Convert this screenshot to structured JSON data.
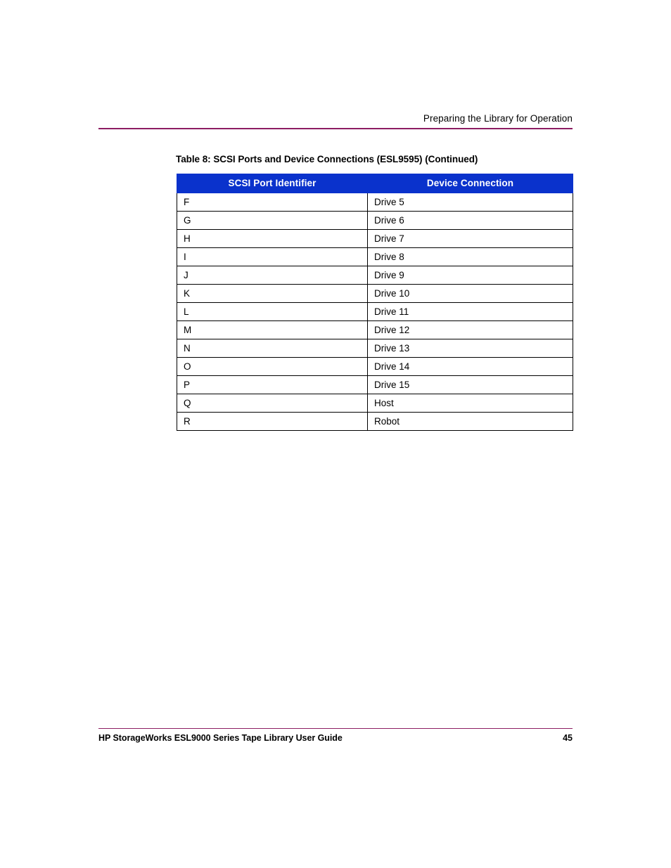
{
  "colors": {
    "rule": "#8c1d62",
    "table_header_bg": "#0a32cc",
    "table_header_text": "#ffffff",
    "table_border": "#000000",
    "page_bg": "#ffffff",
    "body_text": "#000000"
  },
  "header": {
    "running_title": "Preparing the Library for Operation"
  },
  "table": {
    "caption": "Table 8:  SCSI Ports and Device Connections (ESL9595) (Continued)",
    "columns": [
      "SCSI Port Identifier",
      "Device Connection"
    ],
    "rows": [
      {
        "port": "F",
        "device": "Drive 5"
      },
      {
        "port": "G",
        "device": "Drive 6"
      },
      {
        "port": "H",
        "device": "Drive 7"
      },
      {
        "port": "I",
        "device": "Drive 8"
      },
      {
        "port": "J",
        "device": "Drive 9"
      },
      {
        "port": "K",
        "device": "Drive 10"
      },
      {
        "port": "L",
        "device": "Drive 11"
      },
      {
        "port": "M",
        "device": "Drive 12"
      },
      {
        "port": "N",
        "device": "Drive 13"
      },
      {
        "port": "O",
        "device": "Drive 14"
      },
      {
        "port": "P",
        "device": "Drive 15"
      },
      {
        "port": "Q",
        "device": "Host"
      },
      {
        "port": "R",
        "device": "Robot"
      }
    ]
  },
  "footer": {
    "document_title": "HP StorageWorks ESL9000 Series Tape Library User Guide",
    "page_number": "45"
  }
}
